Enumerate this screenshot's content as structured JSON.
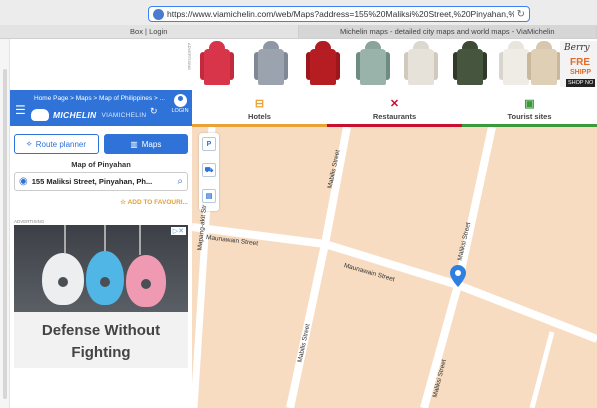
{
  "browser": {
    "url": "https://www.viamichelin.com/web/Maps?address=155%20Maliksi%20Street,%20Pinyahan,%20Philippines",
    "tabs": [
      {
        "label": "Box | Login"
      },
      {
        "label": "Michelin maps - detailed city maps and world maps - ViaMichelin"
      }
    ]
  },
  "banner": {
    "vertical_label": "ADVERTISING",
    "brand": "Berry",
    "free_text": "FRE",
    "ship_text": "SHIPP",
    "shop_text": "SHOP NO",
    "coats": [
      "red coat",
      "grey coat",
      "red puffer",
      "grey coat",
      "white coat",
      "green coat",
      "white coat",
      "beige coat"
    ]
  },
  "header": {
    "breadcrumb": "Home Page > Maps > Map of Philippines > ...",
    "logo_text": "MICHELIN",
    "logo_sub": "VIAMICHELIN",
    "login_label": "LOGIN"
  },
  "panel": {
    "route_planner_label": "Route planner",
    "maps_label": "Maps",
    "map_title": "Map of Pinyahan",
    "address_value": "155 Maliksi Street, Pinyahan, Ph...",
    "add_to_favourites_label": "ADD TO FAVOURI...",
    "ad_label": "ADVERTISING",
    "ad_headline_1": "Defense Without",
    "ad_headline_2": "Fighting"
  },
  "categories": [
    {
      "label": "Hotels",
      "icon": "bed-icon",
      "color": "#e8a235"
    },
    {
      "label": "Restaurants",
      "icon": "cutlery-icon",
      "color": "#c8102e"
    },
    {
      "label": "Tourist sites",
      "icon": "camera-icon",
      "color": "#3c9a3c"
    }
  ],
  "map": {
    "streets": {
      "mabilis_1": "Mabilis Street",
      "maunawain_1": "Maunawain Street",
      "maunawain_2": "Maunawain Street",
      "maliksi_1": "Maliksi Street",
      "maliksi_2": "Maliksi Street",
      "mabilis_2": "Mabilis Street",
      "mapang_akit": "Mapang-akit Str"
    },
    "tools": [
      "P",
      "car",
      "pdf"
    ],
    "colors": {
      "land": "#f7dcc1",
      "road": "#ffffff",
      "pin": "#2f7fe0"
    }
  }
}
